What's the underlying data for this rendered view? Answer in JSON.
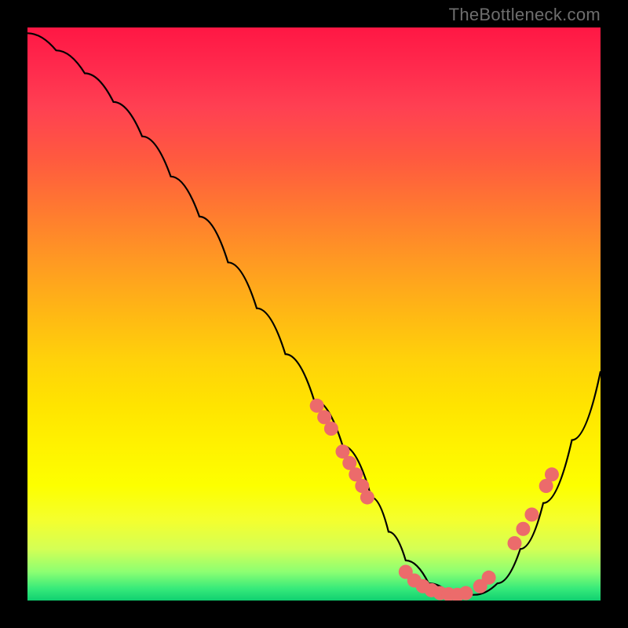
{
  "watermark": "TheBottleneck.com",
  "chart_data": {
    "type": "line",
    "title": "",
    "xlabel": "",
    "ylabel": "",
    "xlim": [
      0,
      100
    ],
    "ylim": [
      0,
      100
    ],
    "grid": false,
    "series": [
      {
        "name": "curve",
        "x": [
          0,
          5,
          10,
          15,
          20,
          25,
          30,
          35,
          40,
          45,
          50,
          55,
          60,
          63,
          66,
          70,
          74,
          78,
          82,
          86,
          90,
          95,
          100
        ],
        "values": [
          99,
          96,
          92,
          87,
          81,
          74,
          67,
          59,
          51,
          43,
          35,
          27,
          18,
          12,
          7,
          3,
          1,
          1,
          3,
          9,
          17,
          28,
          40
        ]
      },
      {
        "name": "highlights-left-cluster",
        "type": "scatter",
        "points": [
          {
            "x": 50.5,
            "y": 34
          },
          {
            "x": 51.8,
            "y": 32
          },
          {
            "x": 53.0,
            "y": 30
          },
          {
            "x": 55.0,
            "y": 26
          },
          {
            "x": 56.2,
            "y": 24
          },
          {
            "x": 57.3,
            "y": 22
          },
          {
            "x": 58.4,
            "y": 20
          },
          {
            "x": 59.3,
            "y": 18
          }
        ]
      },
      {
        "name": "highlights-valley",
        "type": "scatter",
        "points": [
          {
            "x": 66.0,
            "y": 5
          },
          {
            "x": 67.5,
            "y": 3.5
          },
          {
            "x": 69.0,
            "y": 2.5
          },
          {
            "x": 70.5,
            "y": 1.8
          },
          {
            "x": 72.0,
            "y": 1.3
          },
          {
            "x": 73.5,
            "y": 1.1
          },
          {
            "x": 75.0,
            "y": 1.0
          },
          {
            "x": 76.5,
            "y": 1.3
          },
          {
            "x": 79.0,
            "y": 2.5
          },
          {
            "x": 80.5,
            "y": 4
          }
        ]
      },
      {
        "name": "highlights-right-cluster",
        "type": "scatter",
        "points": [
          {
            "x": 85.0,
            "y": 10
          },
          {
            "x": 86.5,
            "y": 12.5
          },
          {
            "x": 88.0,
            "y": 15
          },
          {
            "x": 90.5,
            "y": 20
          },
          {
            "x": 91.5,
            "y": 22
          }
        ]
      }
    ],
    "point_style": {
      "color": "#ec6b6b",
      "radius": 9
    }
  }
}
